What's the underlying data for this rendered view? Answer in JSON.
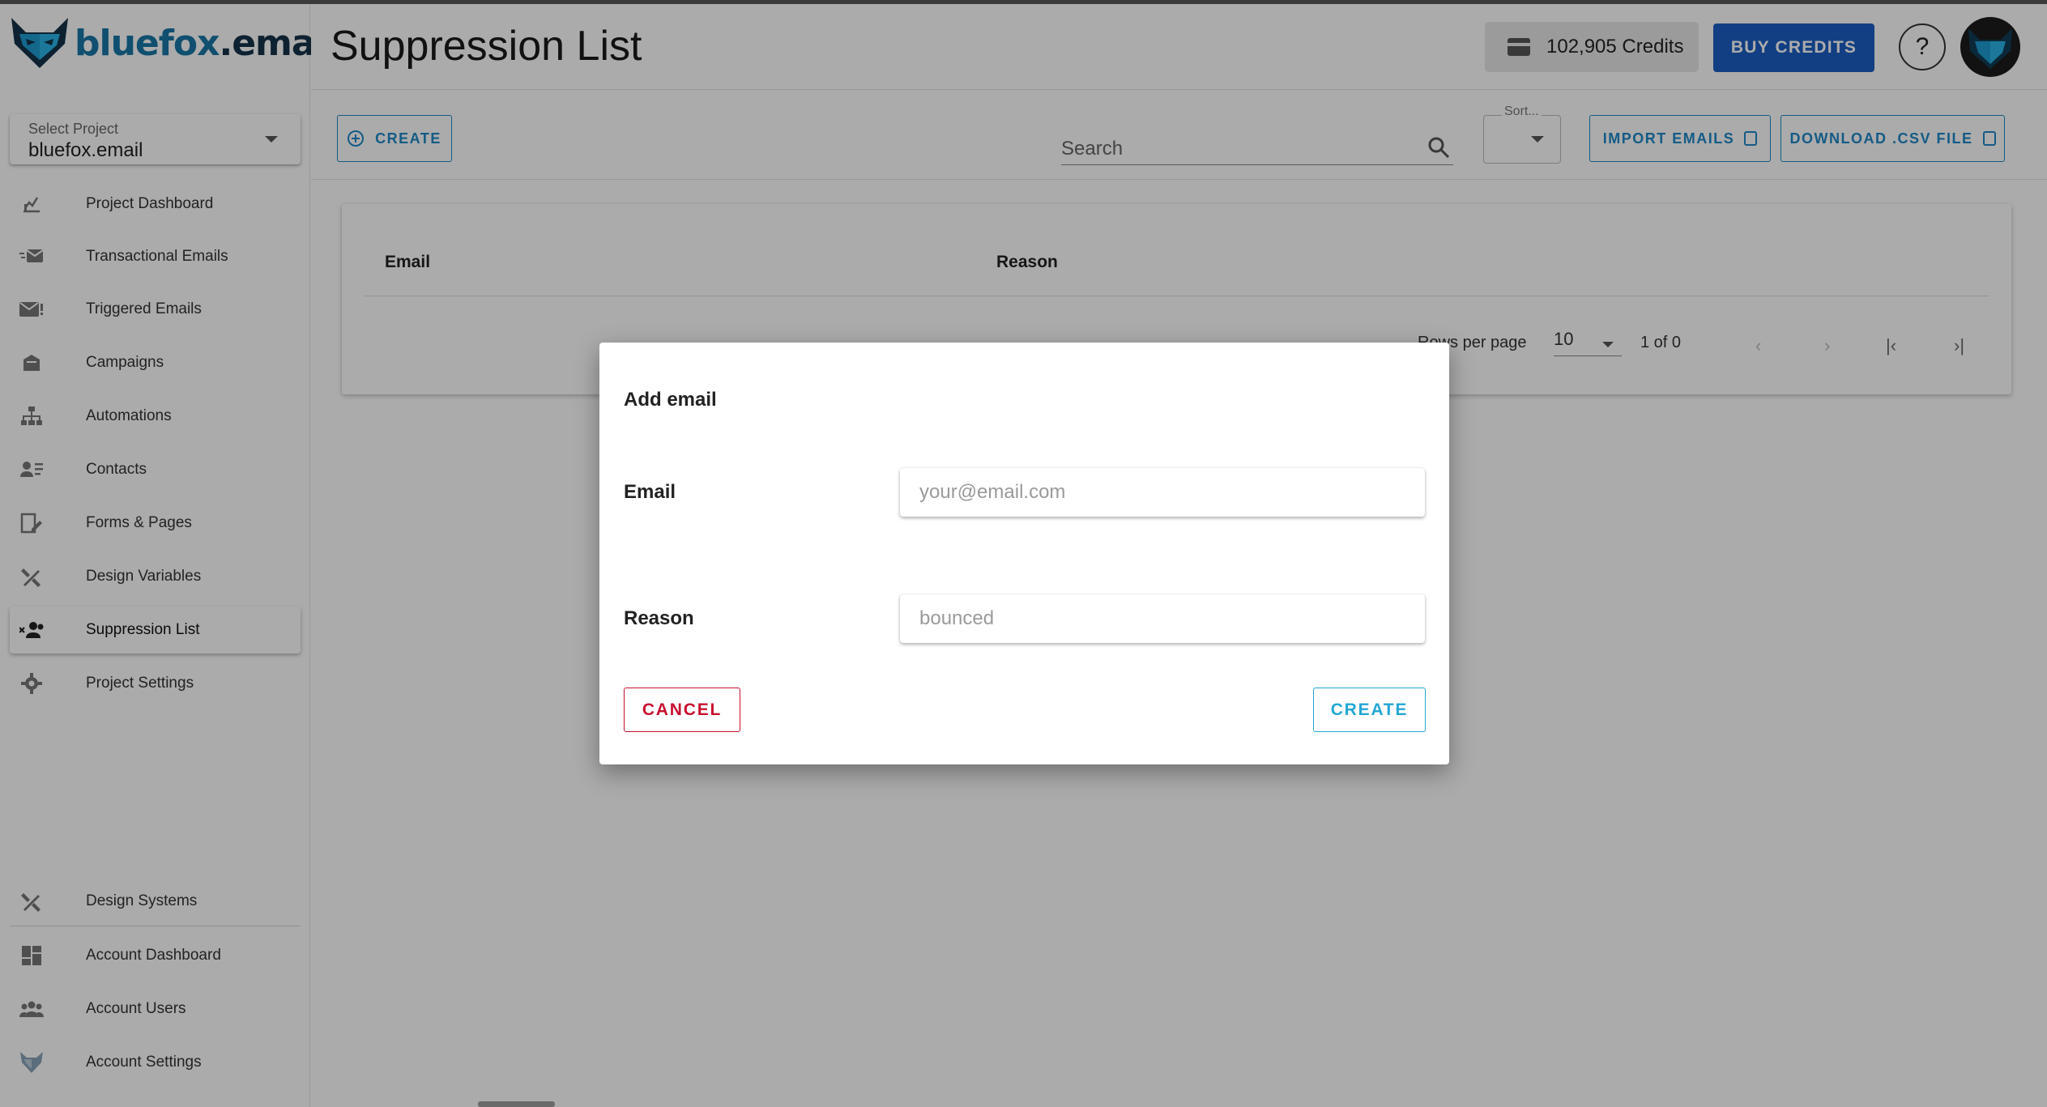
{
  "app": {
    "logo_text_main": "bluefox",
    "logo_text_dot": ".email"
  },
  "sidebar": {
    "project_select": {
      "label": "Select Project",
      "value": "bluefox.email"
    },
    "items": [
      {
        "label": "Project Dashboard",
        "icon": "chart-icon"
      },
      {
        "label": "Transactional Emails",
        "icon": "fast-mail-icon"
      },
      {
        "label": "Triggered Emails",
        "icon": "mail-alert-icon"
      },
      {
        "label": "Campaigns",
        "icon": "inbox-icon"
      },
      {
        "label": "Automations",
        "icon": "sitemap-icon"
      },
      {
        "label": "Contacts",
        "icon": "contacts-icon"
      },
      {
        "label": "Forms & Pages",
        "icon": "form-icon"
      },
      {
        "label": "Design Variables",
        "icon": "design-tools-icon"
      },
      {
        "label": "Suppression List",
        "icon": "group-remove-icon",
        "active": true
      },
      {
        "label": "Project Settings",
        "icon": "gear-icon"
      }
    ],
    "bottom_items": [
      {
        "label": "Design Systems",
        "icon": "design-tools-icon"
      },
      {
        "label": "Account Dashboard",
        "icon": "dashboard-icon"
      },
      {
        "label": "Account Users",
        "icon": "users-icon"
      },
      {
        "label": "Account Settings",
        "icon": "fox-icon"
      }
    ]
  },
  "header": {
    "title": "Suppression List",
    "credits": "102,905 Credits",
    "buy_label": "BUY CREDITS",
    "help_label": "?"
  },
  "toolbar": {
    "create_label": "CREATE",
    "search_placeholder": "Search",
    "sort_label": "Sort...",
    "import_label": "IMPORT EMAILS",
    "download_label": "DOWNLOAD .CSV FILE"
  },
  "table": {
    "columns": [
      "Email",
      "Reason"
    ],
    "rows": [],
    "rows_per_page_label": "Rows per page",
    "rows_per_page_value": "10",
    "range": "1 of 0"
  },
  "modal": {
    "title": "Add email",
    "email_label": "Email",
    "email_placeholder": "your@email.com",
    "reason_label": "Reason",
    "reason_placeholder": "bounced",
    "cancel_label": "CANCEL",
    "create_label": "CREATE"
  },
  "colors": {
    "brand": "#1877a6",
    "primary_button": "#1b5fc4",
    "outline_accent": "#1e88c8",
    "danger": "#c8102e",
    "modal_create": "#24a7d6"
  }
}
